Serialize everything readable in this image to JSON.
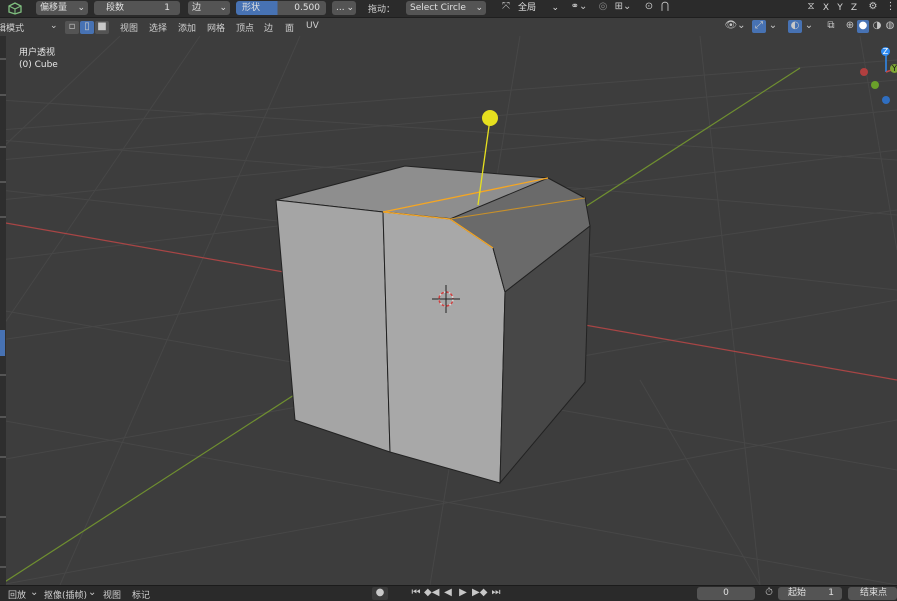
{
  "header": {
    "transform_label": "偏移量",
    "segments_label": "段数",
    "segments_value": "1",
    "affect_label": "边",
    "shape_label": "形状",
    "shape_value": "0.500",
    "more_label": "...",
    "drag_label": "拖动：",
    "select_tool": "Select Circle",
    "orientation": "全局",
    "view_buttons": [
      "X",
      "Y",
      "Z"
    ]
  },
  "subheader": {
    "mode": "编辑模式",
    "menus": [
      "视图",
      "选择",
      "添加",
      "网格",
      "顶点",
      "边",
      "面",
      "UV"
    ]
  },
  "viewport": {
    "perspective_label": "用户透视",
    "object_label": "(0) Cube",
    "gizmo_axes": [
      "Z",
      "Y"
    ]
  },
  "timeline": {
    "menus": [
      "回放",
      "抠像(插帧)",
      "视图",
      "标记"
    ],
    "current_frame": "0",
    "start_label": "起始",
    "start_value": "1",
    "end_label": "结束点"
  },
  "colors": {
    "accent": "#4772b3",
    "selected_edge": "#f5a623",
    "x_axis": "#c44a4a",
    "y_axis": "#7ea634",
    "gizmo_z": "#2f8cf4",
    "handle": "#e6e01f"
  }
}
